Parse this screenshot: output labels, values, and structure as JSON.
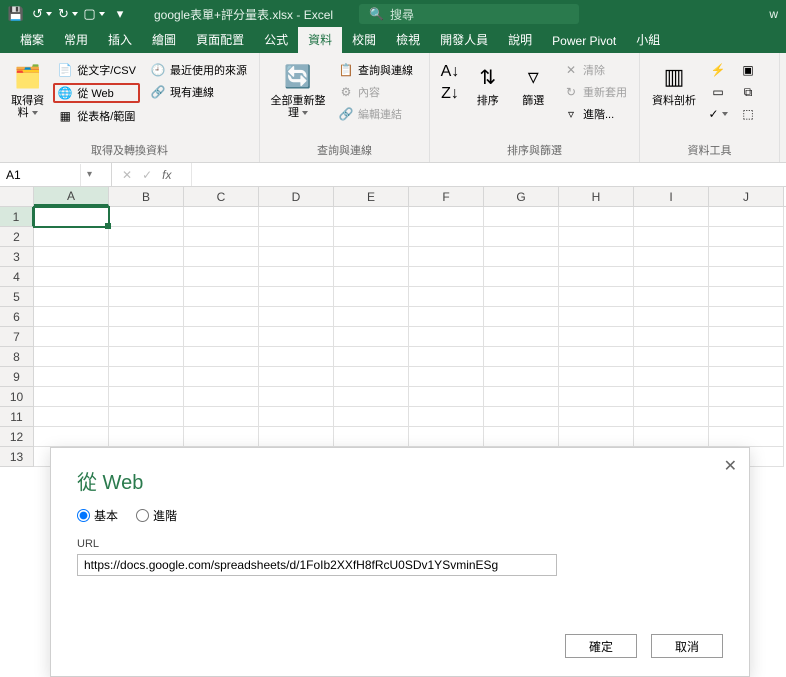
{
  "title": "google表單+評分量表.xlsx - Excel",
  "search_placeholder": "搜尋",
  "user_hint": "w",
  "tabs": [
    "檔案",
    "常用",
    "插入",
    "繪圖",
    "頁面配置",
    "公式",
    "資料",
    "校閱",
    "檢視",
    "開發人員",
    "說明",
    "Power Pivot",
    "小組"
  ],
  "active_tab": "資料",
  "ribbon": {
    "group1": {
      "big": "取得資\n料",
      "items": [
        "從文字/CSV",
        "從 Web",
        "從表格/範圍",
        "最近使用的來源",
        "現有連線"
      ],
      "label": "取得及轉換資料"
    },
    "group2": {
      "big": "全部重新整理",
      "items": [
        "查詢與連線",
        "內容",
        "編輯連結"
      ],
      "label": "查詢與連線"
    },
    "group3": {
      "sort": "排序",
      "filter": "篩選",
      "items": [
        "清除",
        "重新套用",
        "進階..."
      ],
      "label": "排序與篩選"
    },
    "group4": {
      "big": "資料剖析",
      "label": "資料工具"
    }
  },
  "namebox": "A1",
  "columns": [
    "A",
    "B",
    "C",
    "D",
    "E",
    "F",
    "G",
    "H",
    "I",
    "J"
  ],
  "rows": [
    "1",
    "2",
    "3",
    "4",
    "5",
    "6",
    "7",
    "8",
    "9",
    "10",
    "11",
    "12",
    "13"
  ],
  "dialog": {
    "title": "從 Web",
    "radio_basic": "基本",
    "radio_advanced": "進階",
    "url_label": "URL",
    "url_value": "https://docs.google.com/spreadsheets/d/1FoIb2XXfH8fRcU0SDv1YSvminESg",
    "ok": "確定",
    "cancel": "取消"
  }
}
